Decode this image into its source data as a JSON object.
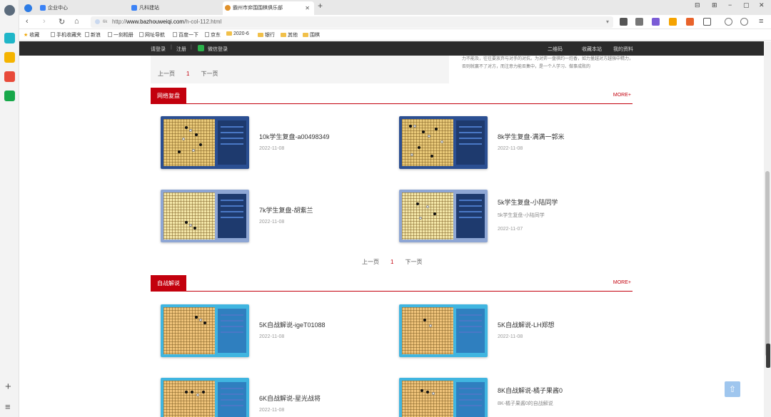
{
  "browser": {
    "tabs": [
      {
        "label": "企业中心"
      },
      {
        "label": "凡科建站"
      },
      {
        "label": "霸州市弈围围棋俱乐部"
      }
    ],
    "url_prefix": "http://",
    "url_domain": "www.bazhouweiqi.com",
    "url_path": "/h-col-112.html",
    "url_tag": "6k",
    "window_controls": [
      "⊟",
      "⊞",
      "−",
      "▢",
      "✕"
    ]
  },
  "bookmarks": [
    {
      "label": "收藏",
      "kind": "star"
    },
    {
      "label": "手机收藏夹",
      "kind": "doc"
    },
    {
      "label": "新浪",
      "kind": "doc"
    },
    {
      "label": "一刻相册",
      "kind": "doc"
    },
    {
      "label": "网址导航",
      "kind": "doc"
    },
    {
      "label": "百度一下",
      "kind": "doc"
    },
    {
      "label": "京东",
      "kind": "doc"
    },
    {
      "label": "2020-6",
      "kind": "folder"
    },
    {
      "label": "银行",
      "kind": "folder"
    },
    {
      "label": "其他",
      "kind": "folder"
    },
    {
      "label": "围棋",
      "kind": "folder"
    }
  ],
  "site_bar": {
    "login": "请登录",
    "register": "注册",
    "wechat_login": "微信登录",
    "qrcode": "二维码",
    "favorite": "收藏本站",
    "my_profile": "我的资料"
  },
  "top_pager": {
    "prev": "上一页",
    "current": "1",
    "next": "下一页"
  },
  "right_text": "力不能及，往往要放弃与对手的对抗。为对弈一盘棋约一炷香，如力量越对方越强中精力，否则就赢不了对方，而注意力能否集中，是一个人学习、做事成败的",
  "section1": {
    "title": "网络复盘",
    "more": "MORE+",
    "items": [
      {
        "title": "10k学生复盘-a00498349",
        "sub": "",
        "date": "2022-11-08"
      },
      {
        "title": "8k学生复盘-满满一郭米",
        "sub": "",
        "date": "2022-11-08"
      },
      {
        "title": "7k学生复盘-胡紫兰",
        "sub": "",
        "date": "2022-11-08"
      },
      {
        "title": "5k学生复盘-小陆同学",
        "sub": "5k学生复盘-小陆同学",
        "date": "2022-11-07"
      }
    ],
    "pager": {
      "prev": "上一页",
      "current": "1",
      "next": "下一页"
    }
  },
  "section2": {
    "title": "自战解说",
    "more": "MORE+",
    "items": [
      {
        "title": "5K自战解说-igeT01088",
        "sub": "",
        "date": "2022-11-08"
      },
      {
        "title": "5K自战解说-LH郑想",
        "sub": "",
        "date": "2022-11-08"
      },
      {
        "title": "6K自战解说-星光战将",
        "sub": "",
        "date": "2022-11-08"
      },
      {
        "title": "8K自战解说-橘子果酱0",
        "sub": "8K-橘子果酱0的自战解说",
        "date": ""
      }
    ]
  },
  "colors": {
    "accent": "#c3000d",
    "site_bar": "#2b2b2b"
  }
}
